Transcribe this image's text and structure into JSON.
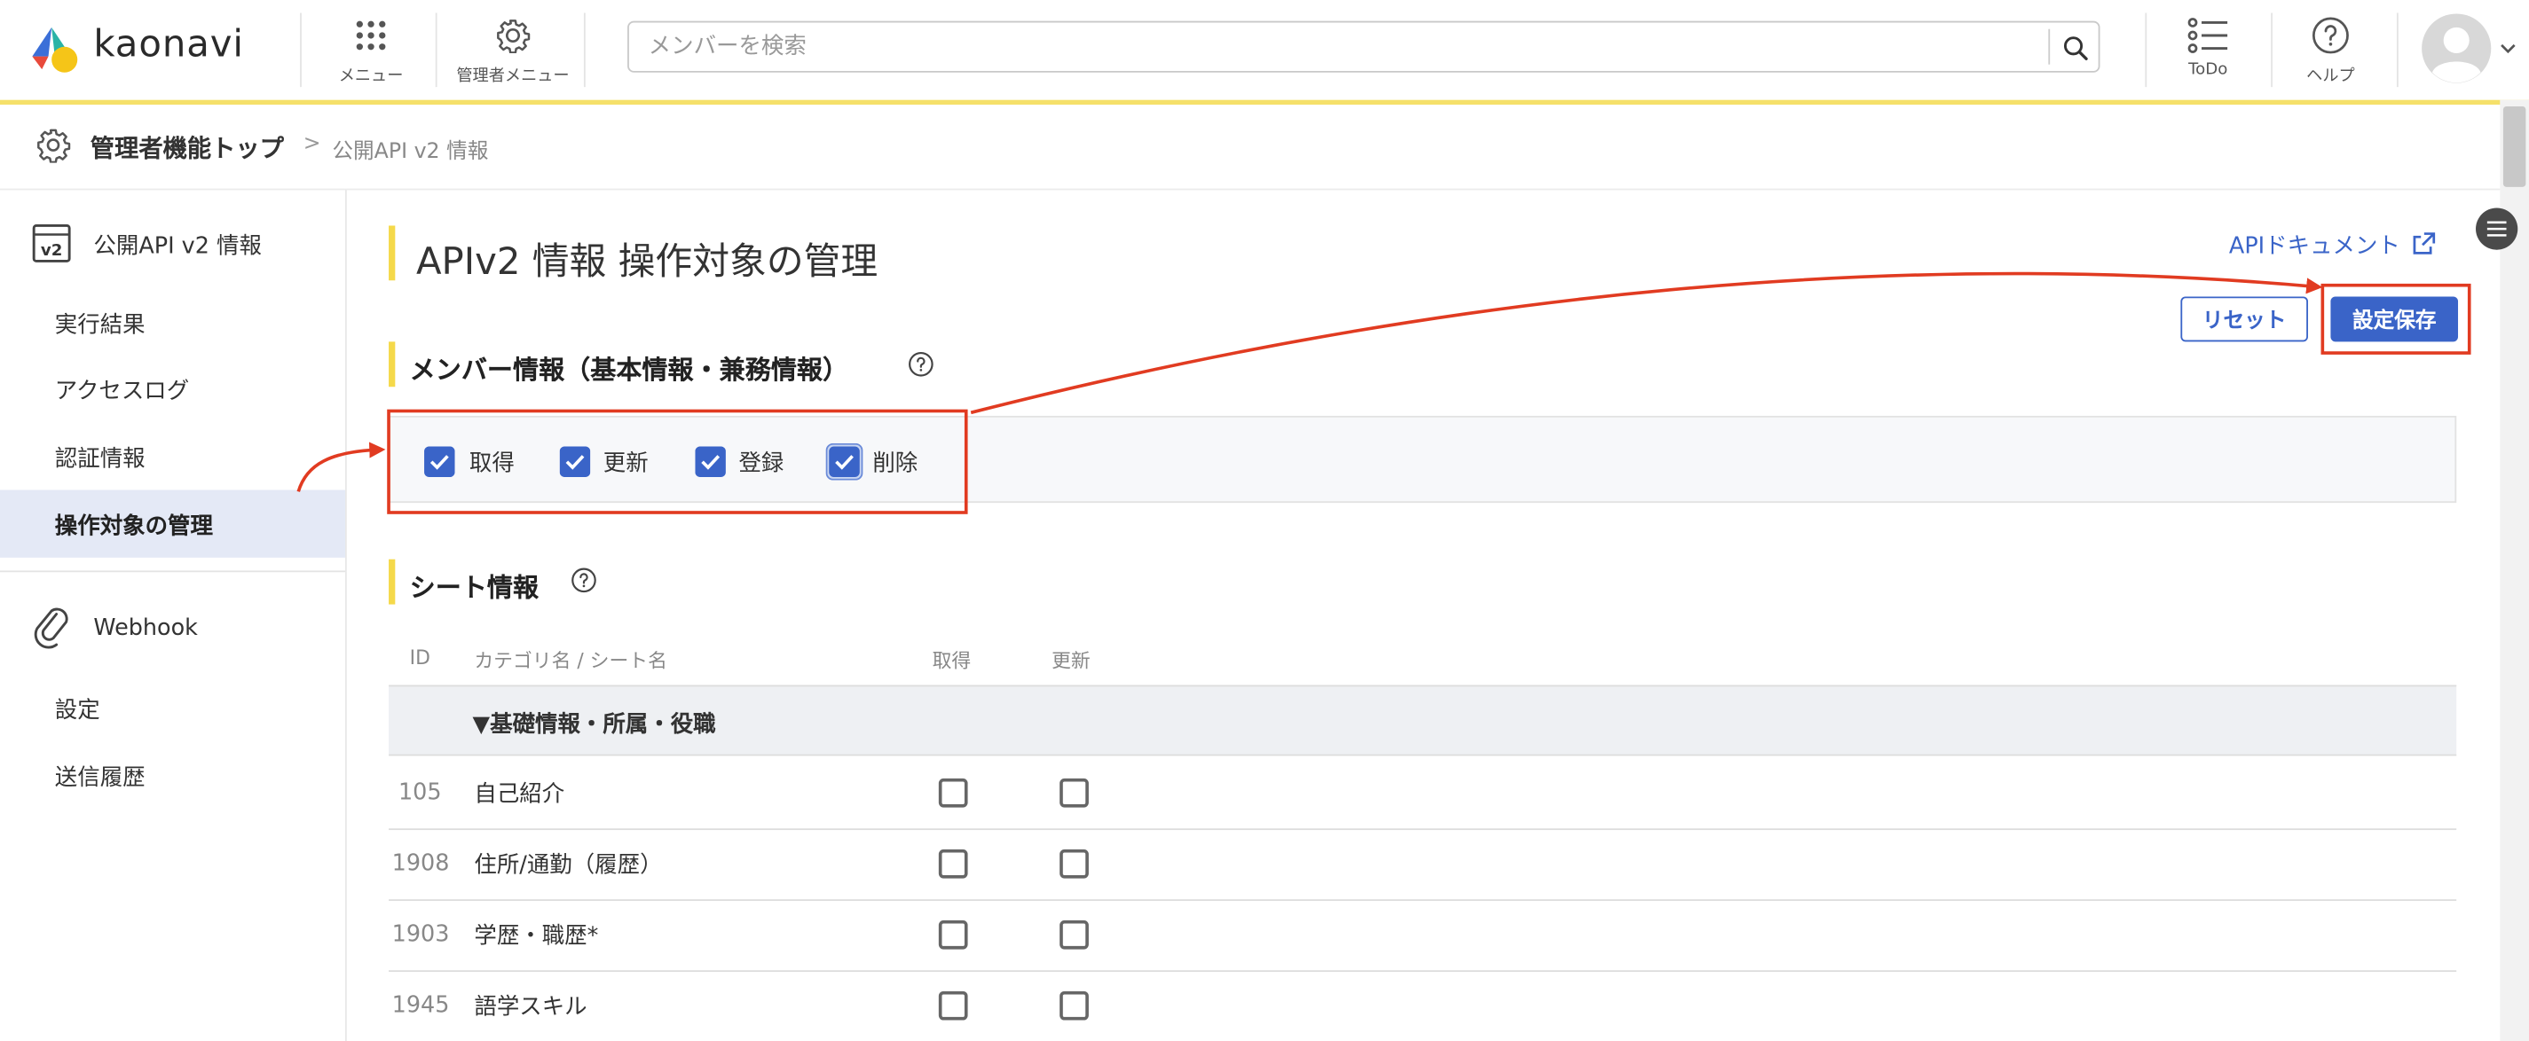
{
  "header": {
    "logo_text": "kaonavi",
    "menu_label": "メニュー",
    "admin_menu_label": "管理者メニュー",
    "search_placeholder": "メンバーを検索",
    "todo_label": "ToDo",
    "help_label": "ヘルプ"
  },
  "breadcrumb": {
    "root": "管理者機能トップ",
    "separator": ">",
    "current": "公開API v2 情報"
  },
  "sidebar": {
    "section1_title": "公開API v2 情報",
    "section1_icon_text": "v2",
    "section1_items": [
      {
        "label": "実行結果",
        "active": false
      },
      {
        "label": "アクセスログ",
        "active": false
      },
      {
        "label": "認証情報",
        "active": false
      },
      {
        "label": "操作対象の管理",
        "active": true
      }
    ],
    "section2_title": "Webhook",
    "section2_items": [
      {
        "label": "設定"
      },
      {
        "label": "送信履歴"
      }
    ]
  },
  "main": {
    "page_title": "APIv2 情報 操作対象の管理",
    "api_doc_link": "APIドキュメント",
    "reset_button": "リセット",
    "save_button": "設定保存",
    "member_section_title": "メンバー情報（基本情報・兼務情報）",
    "member_permissions": [
      {
        "label": "取得",
        "checked": true
      },
      {
        "label": "更新",
        "checked": true
      },
      {
        "label": "登録",
        "checked": true
      },
      {
        "label": "削除",
        "checked": true
      }
    ],
    "sheet_section_title": "シート情報",
    "table_headers": {
      "id": "ID",
      "name": "カテゴリ名 / シート名",
      "get": "取得",
      "update": "更新"
    },
    "category_row": "▼基礎情報・所属・役職",
    "rows": [
      {
        "id": "105",
        "name": "自己紹介",
        "get": false,
        "update": false
      },
      {
        "id": "1908",
        "name": "住所/通勤（履歴）",
        "get": false,
        "update": false
      },
      {
        "id": "1903",
        "name": "学歴・職歴*",
        "get": false,
        "update": false
      },
      {
        "id": "1945",
        "name": "語学スキル",
        "get": false,
        "update": false
      }
    ]
  },
  "colors": {
    "accent_blue": "#3a64c8",
    "highlight_yellow": "#f5d94a",
    "annotation_red": "#e13b21",
    "active_bg": "#e4e9f6"
  }
}
